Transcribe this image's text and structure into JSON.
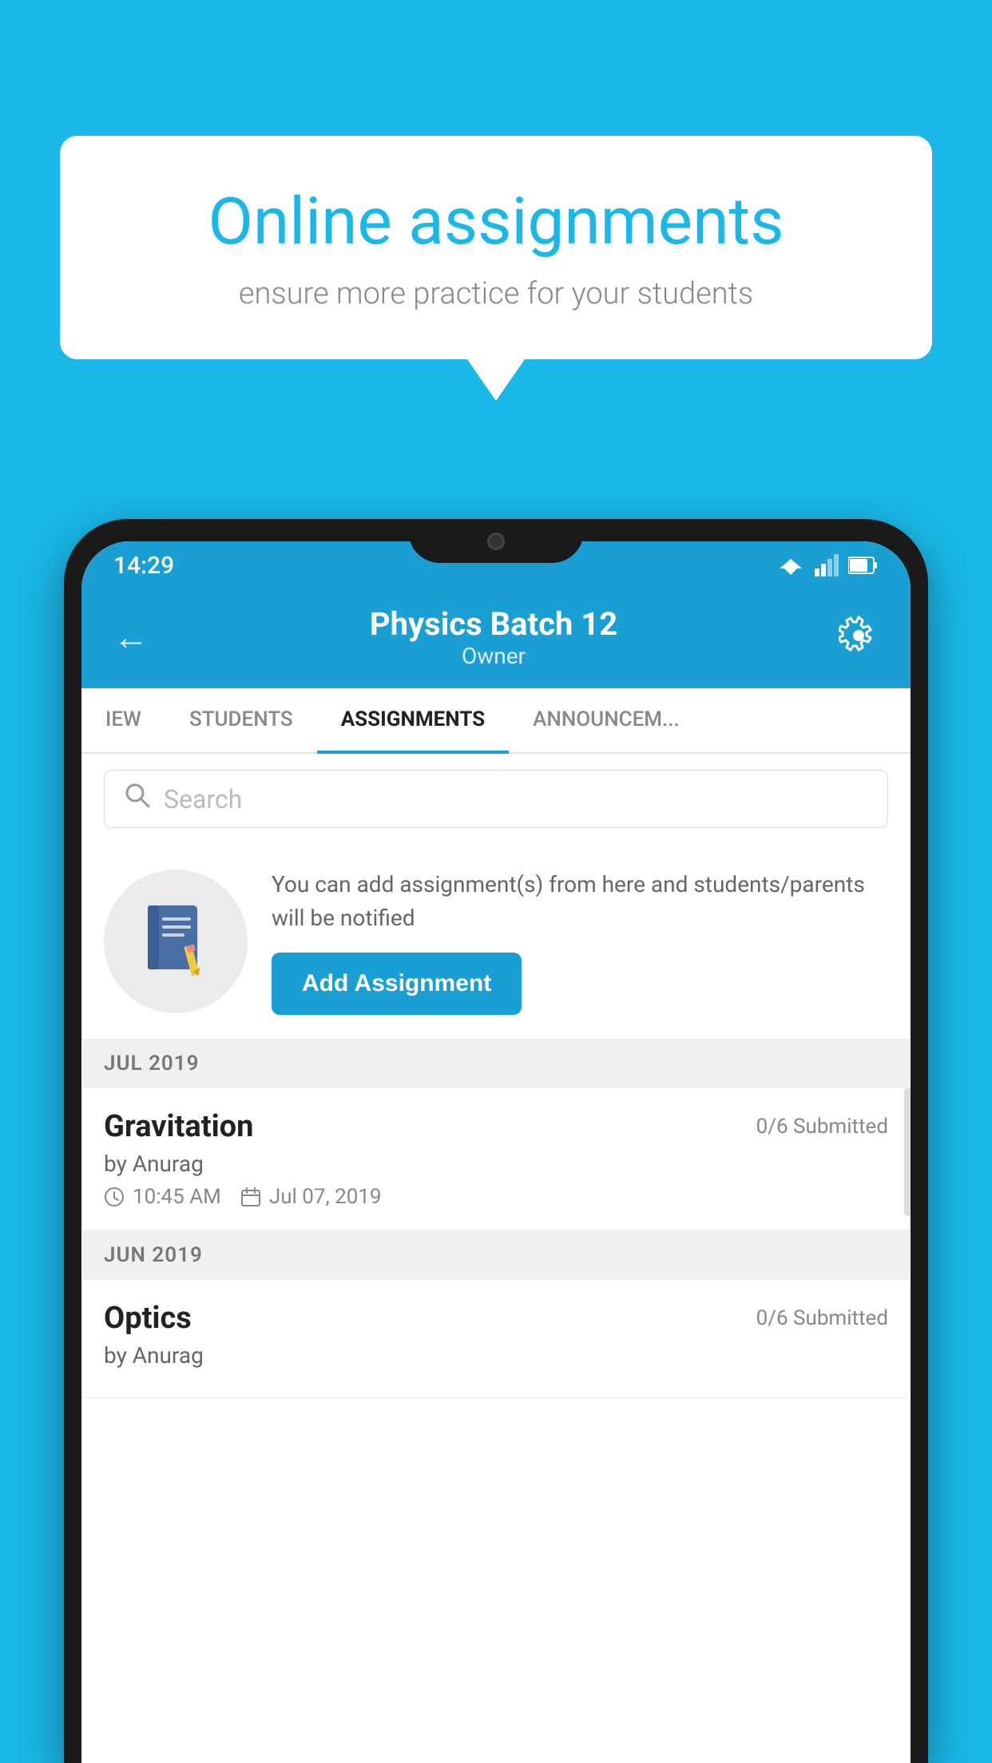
{
  "background_color": "#1ab8e8",
  "speech_bubble": {
    "title": "Online assignments",
    "subtitle": "ensure more practice for your students"
  },
  "phone": {
    "status_bar": {
      "time": "14:29"
    },
    "header": {
      "title": "Physics Batch 12",
      "subtitle": "Owner",
      "back_label": "←",
      "settings_label": "⚙"
    },
    "tabs": [
      {
        "label": "IEW",
        "active": false
      },
      {
        "label": "STUDENTS",
        "active": false
      },
      {
        "label": "ASSIGNMENTS",
        "active": true
      },
      {
        "label": "ANNOUNCEM...",
        "active": false
      }
    ],
    "search": {
      "placeholder": "Search"
    },
    "promo": {
      "description": "You can add assignment(s) from here and students/parents will be notified",
      "button_label": "Add Assignment"
    },
    "sections": [
      {
        "label": "JUL 2019",
        "assignments": [
          {
            "title": "Gravitation",
            "submitted": "0/6 Submitted",
            "author": "by Anurag",
            "time": "10:45 AM",
            "date": "Jul 07, 2019"
          }
        ]
      },
      {
        "label": "JUN 2019",
        "assignments": [
          {
            "title": "Optics",
            "submitted": "0/6 Submitted",
            "author": "by Anurag",
            "time": "",
            "date": ""
          }
        ]
      }
    ]
  }
}
